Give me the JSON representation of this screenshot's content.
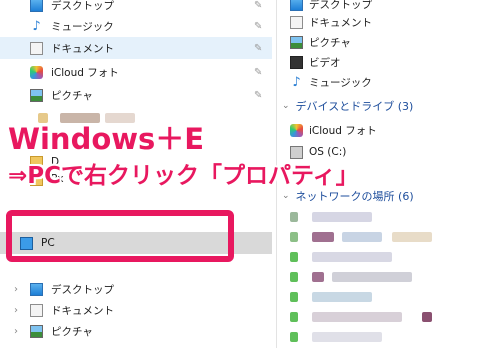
{
  "left_nav": {
    "desktop": "デスクトップ",
    "music": "ミュージック",
    "documents": "ドキュメント",
    "icloud": "iCloud フォト",
    "pictures": "ピクチャ",
    "pc": "PC",
    "pc_desktop": "デスクトップ",
    "pc_documents": "ドキュメント",
    "pc_pictures": "ピクチャ",
    "partial_d": "D",
    "partial_p": "Px"
  },
  "right_pane": {
    "desktop": "デスクトップ",
    "documents": "ドキュメント",
    "pictures": "ピクチャ",
    "videos": "ビデオ",
    "music": "ミュージック",
    "devices_header": "デバイスとドライブ (3)",
    "icloud": "iCloud フォト",
    "os_drive": "OS (C:)",
    "network_header": "ネットワークの場所 (6)"
  },
  "overlay": {
    "line1": "Windows＋E",
    "line2": "⇒PCで右クリック「プロパティ」"
  },
  "icons": {
    "pin": "pin-icon",
    "chevron": "chevron-right-icon"
  },
  "colors": {
    "accent": "#e8185f",
    "selection": "#e5f1fb",
    "pc_highlight": "#d9d9d9",
    "section_blue": "#1e4e9c"
  }
}
